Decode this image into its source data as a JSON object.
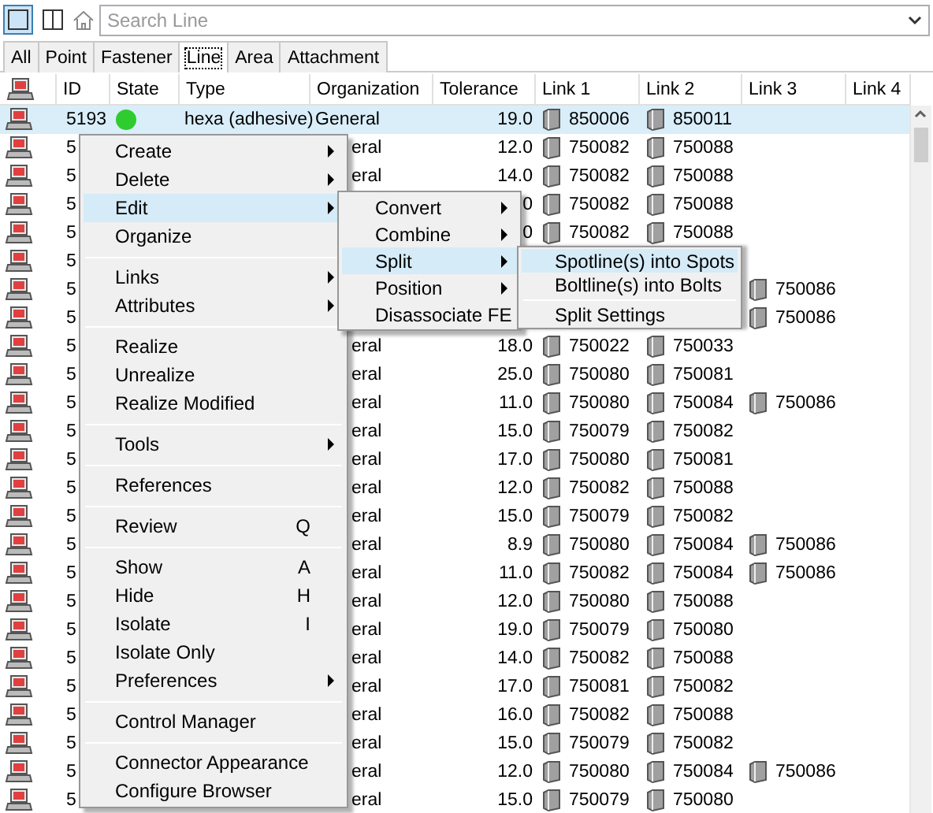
{
  "toolbar": {
    "views": [
      {
        "kind": "single",
        "selected": true
      },
      {
        "kind": "split",
        "selected": false
      }
    ],
    "search": {
      "placeholder": "Search Line"
    }
  },
  "tabs": [
    {
      "label": "All",
      "selected": false
    },
    {
      "label": "Point",
      "selected": false
    },
    {
      "label": "Fastener",
      "selected": false
    },
    {
      "label": "Line",
      "selected": true
    },
    {
      "label": "Area",
      "selected": false
    },
    {
      "label": "Attachment",
      "selected": false
    }
  ],
  "table": {
    "columns": [
      "ID",
      "State",
      "Type",
      "Organization",
      "Tolerance",
      "Link 1",
      "Link 2",
      "Link 3",
      "Link 4"
    ],
    "rows": [
      {
        "selected": true,
        "id": "5193",
        "color": "#2ecc2e",
        "type": "hexa (adhesive)",
        "organization": "General",
        "tolerance": "19.0",
        "link_1": "850006",
        "link_2": "850011"
      },
      {
        "selected": false,
        "id": "5",
        "organization": "eral",
        "tolerance": "12.0",
        "link_1": "750082",
        "link_2": "750088"
      },
      {
        "selected": false,
        "id": "5",
        "organization": "eral",
        "tolerance": "14.0",
        "link_1": "750082",
        "link_2": "750088"
      },
      {
        "selected": false,
        "id": "5",
        "tolerance": "0",
        "link_1": "750082",
        "link_2": "750088"
      },
      {
        "selected": false,
        "id": "5",
        "tolerance": "0",
        "link_1": "750082",
        "link_2": "750088"
      },
      {
        "selected": false,
        "id": "5"
      },
      {
        "selected": false,
        "id": "5",
        "link_3": "750086"
      },
      {
        "selected": false,
        "id": "5",
        "link_3": "750086"
      },
      {
        "selected": false,
        "id": "5",
        "organization": "eral",
        "tolerance": "18.0",
        "link_1": "750022",
        "link_2": "750033"
      },
      {
        "selected": false,
        "id": "5",
        "organization": "eral",
        "tolerance": "25.0",
        "link_1": "750080",
        "link_2": "750081"
      },
      {
        "selected": false,
        "id": "5",
        "organization": "eral",
        "tolerance": "11.0",
        "link_1": "750080",
        "link_2": "750084",
        "link_3": "750086"
      },
      {
        "selected": false,
        "id": "5",
        "organization": "eral",
        "tolerance": "15.0",
        "link_1": "750079",
        "link_2": "750082"
      },
      {
        "selected": false,
        "id": "5",
        "organization": "eral",
        "tolerance": "17.0",
        "link_1": "750080",
        "link_2": "750081"
      },
      {
        "selected": false,
        "id": "5",
        "organization": "eral",
        "tolerance": "12.0",
        "link_1": "750082",
        "link_2": "750088"
      },
      {
        "selected": false,
        "id": "5",
        "organization": "eral",
        "tolerance": "15.0",
        "link_1": "750079",
        "link_2": "750082"
      },
      {
        "selected": false,
        "id": "5",
        "organization": "eral",
        "tolerance": "8.9",
        "link_1": "750080",
        "link_2": "750084",
        "link_3": "750086"
      },
      {
        "selected": false,
        "id": "5",
        "organization": "eral",
        "tolerance": "11.0",
        "link_1": "750082",
        "link_2": "750084",
        "link_3": "750086"
      },
      {
        "selected": false,
        "id": "5",
        "organization": "eral",
        "tolerance": "12.0",
        "link_1": "750080",
        "link_2": "750088"
      },
      {
        "selected": false,
        "id": "5",
        "organization": "eral",
        "tolerance": "19.0",
        "link_1": "750079",
        "link_2": "750080"
      },
      {
        "selected": false,
        "id": "5",
        "organization": "eral",
        "tolerance": "14.0",
        "link_1": "750082",
        "link_2": "750088"
      },
      {
        "selected": false,
        "id": "5",
        "organization": "eral",
        "tolerance": "17.0",
        "link_1": "750081",
        "link_2": "750082"
      },
      {
        "selected": false,
        "id": "5",
        "organization": "eral",
        "tolerance": "16.0",
        "link_1": "750082",
        "link_2": "750088"
      },
      {
        "selected": false,
        "id": "5",
        "organization": "eral",
        "tolerance": "15.0",
        "link_1": "750079",
        "link_2": "750082"
      },
      {
        "selected": false,
        "id": "5",
        "organization": "eral",
        "tolerance": "12.0",
        "link_1": "750080",
        "link_2": "750084",
        "link_3": "750086"
      },
      {
        "selected": false,
        "id": "5",
        "organization": "eral",
        "tolerance": "15.0",
        "link_1": "750079",
        "link_2": "750080"
      }
    ]
  },
  "context_menu": [
    {
      "kind": "item",
      "label": "Create",
      "submenu": true,
      "selected": false
    },
    {
      "kind": "item",
      "label": "Delete",
      "submenu": true,
      "selected": false
    },
    {
      "kind": "item",
      "label": "Edit",
      "submenu": true,
      "selected": true
    },
    {
      "kind": "item",
      "label": "Organize",
      "submenu": false,
      "selected": false
    },
    {
      "kind": "separator"
    },
    {
      "kind": "item",
      "label": "Links",
      "submenu": true,
      "selected": false
    },
    {
      "kind": "item",
      "label": "Attributes",
      "submenu": true,
      "selected": false
    },
    {
      "kind": "separator"
    },
    {
      "kind": "item",
      "label": "Realize",
      "submenu": false,
      "selected": false
    },
    {
      "kind": "item",
      "label": "Unrealize",
      "submenu": false,
      "selected": false
    },
    {
      "kind": "item",
      "label": "Realize Modified",
      "submenu": false,
      "selected": false
    },
    {
      "kind": "separator"
    },
    {
      "kind": "item",
      "label": "Tools",
      "submenu": true,
      "selected": false
    },
    {
      "kind": "separator"
    },
    {
      "kind": "item",
      "label": "References",
      "submenu": false,
      "selected": false
    },
    {
      "kind": "separator"
    },
    {
      "kind": "item",
      "label": "Review",
      "shortcut": "Q",
      "submenu": false,
      "selected": false
    },
    {
      "kind": "separator"
    },
    {
      "kind": "item",
      "label": "Show",
      "shortcut": "A",
      "submenu": false,
      "selected": false
    },
    {
      "kind": "item",
      "label": "Hide",
      "shortcut": "H",
      "submenu": false,
      "selected": false
    },
    {
      "kind": "item",
      "label": "Isolate",
      "shortcut": "I",
      "submenu": false,
      "selected": false
    },
    {
      "kind": "item",
      "label": "Isolate Only",
      "submenu": false,
      "selected": false
    },
    {
      "kind": "item",
      "label": "Preferences",
      "submenu": true,
      "selected": false
    },
    {
      "kind": "separator"
    },
    {
      "kind": "item",
      "label": "Control Manager",
      "submenu": false,
      "selected": false
    },
    {
      "kind": "separator"
    },
    {
      "kind": "item",
      "label": "Connector Appearance",
      "submenu": false,
      "selected": false
    },
    {
      "kind": "item",
      "label": "Configure Browser",
      "submenu": false,
      "selected": false
    }
  ],
  "edit_submenu": [
    {
      "kind": "item",
      "label": "Convert",
      "submenu": true,
      "selected": false
    },
    {
      "kind": "item",
      "label": "Combine",
      "submenu": true,
      "selected": false
    },
    {
      "kind": "item",
      "label": "Split",
      "submenu": true,
      "selected": true
    },
    {
      "kind": "item",
      "label": "Position",
      "submenu": true,
      "selected": false
    },
    {
      "kind": "item",
      "label": "Disassociate FE",
      "submenu": false,
      "selected": false
    }
  ],
  "split_submenu": [
    {
      "kind": "item",
      "label": "Spotline(s) into Spots",
      "submenu": false,
      "selected": true
    },
    {
      "kind": "item",
      "label": "Boltline(s) into Bolts",
      "submenu": false,
      "selected": false
    },
    {
      "kind": "separator"
    },
    {
      "kind": "item",
      "label": "Split Settings",
      "submenu": false,
      "selected": false
    }
  ]
}
